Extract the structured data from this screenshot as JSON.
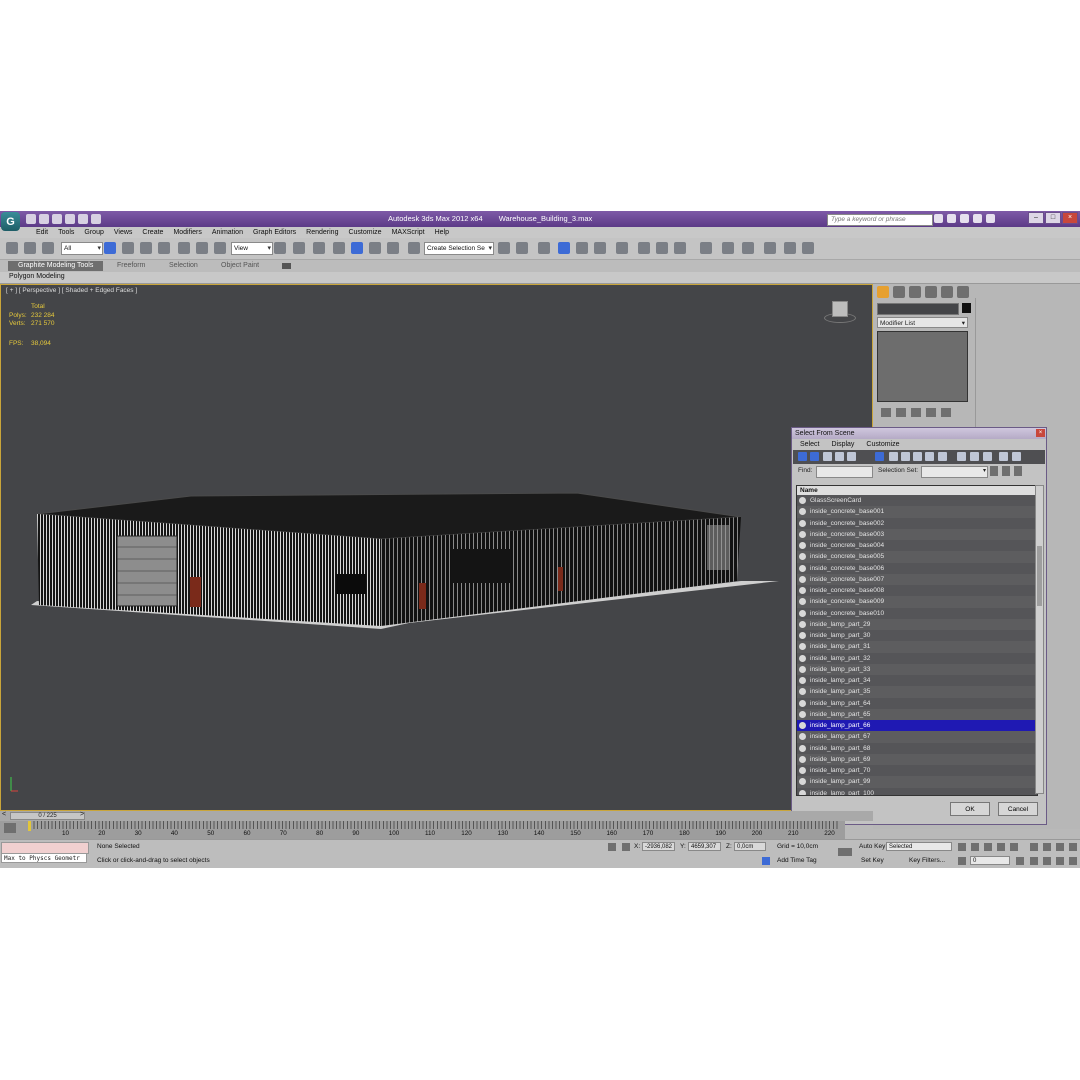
{
  "title_bar": {
    "app_title": "Autodesk 3ds Max  2012 x64",
    "file_name": "Warehouse_Building_3.max",
    "search_placeholder": "Type a keyword or phrase",
    "app_logo": "3ds-max-logo"
  },
  "menu": {
    "items": [
      "Edit",
      "Tools",
      "Group",
      "Views",
      "Create",
      "Modifiers",
      "Animation",
      "Graph Editors",
      "Rendering",
      "Customize",
      "MAXScript",
      "Help"
    ]
  },
  "main_toolbar": {
    "selection_filter": "All",
    "reference_coord": "View",
    "named_selection_placeholder": "Create Selection Se"
  },
  "ribbon": {
    "tabs": [
      "Graphite Modeling Tools",
      "Freeform",
      "Selection",
      "Object Paint"
    ],
    "active_panel": "Polygon Modeling"
  },
  "viewport": {
    "label": "[ + ] [ Perspective ] [ Shaded + Edged Faces ]",
    "stats": {
      "header": "Total",
      "polys_label": "Polys:",
      "polys": "232 284",
      "verts_label": "Verts:",
      "verts": "271 570",
      "fps_label": "FPS:",
      "fps": "38,094"
    }
  },
  "command_panel": {
    "modifier_list_label": "Modifier List"
  },
  "select_dialog": {
    "title": "Select From Scene",
    "menu": [
      "Select",
      "Display",
      "Customize"
    ],
    "find_label": "Find:",
    "selection_set_label": "Selection Set:",
    "column_header": "Name",
    "items": [
      "GlassScreenCard",
      "inside_concrete_base001",
      "inside_concrete_base002",
      "inside_concrete_base003",
      "inside_concrete_base004",
      "inside_concrete_base005",
      "inside_concrete_base006",
      "inside_concrete_base007",
      "inside_concrete_base008",
      "inside_concrete_base009",
      "inside_concrete_base010",
      "inside_lamp_part_29",
      "inside_lamp_part_30",
      "inside_lamp_part_31",
      "inside_lamp_part_32",
      "inside_lamp_part_33",
      "inside_lamp_part_34",
      "inside_lamp_part_35",
      "inside_lamp_part_64",
      "inside_lamp_part_65",
      "inside_lamp_part_66",
      "inside_lamp_part_67",
      "inside_lamp_part_68",
      "inside_lamp_part_69",
      "inside_lamp_part_70",
      "inside_lamp_part_99",
      "inside_lamp_part_100"
    ],
    "selected_item": "inside_lamp_part_66",
    "ok_label": "OK",
    "cancel_label": "Cancel"
  },
  "timeline": {
    "frame_display": "0 / 225",
    "tick_labels": [
      "10",
      "20",
      "30",
      "40",
      "50",
      "60",
      "70",
      "80",
      "90",
      "100",
      "110",
      "120",
      "130",
      "140",
      "150",
      "160",
      "170",
      "180",
      "190",
      "200",
      "210",
      "220"
    ]
  },
  "status": {
    "maxscript_output": "Max to Physcs Geometr",
    "selection_status": "None Selected",
    "prompt": "Click or click-and-drag to select objects",
    "x_label": "X:",
    "x_value": "-2936,082",
    "y_label": "Y:",
    "y_value": "4659,307",
    "z_label": "Z:",
    "z_value": "0,0cm",
    "grid": "Grid = 10,0cm",
    "add_time_tag": "Add Time Tag",
    "auto_key": "Auto Key",
    "auto_key_mode": "Selected",
    "set_key": "Set Key",
    "key_filters": "Key Filters...",
    "current_frame": "0"
  },
  "colors": {
    "title_bar": "#6b4a97",
    "viewport_bg": "#444548",
    "selection_highlight": "#1f19b3",
    "stats_text": "#e6c93c"
  }
}
